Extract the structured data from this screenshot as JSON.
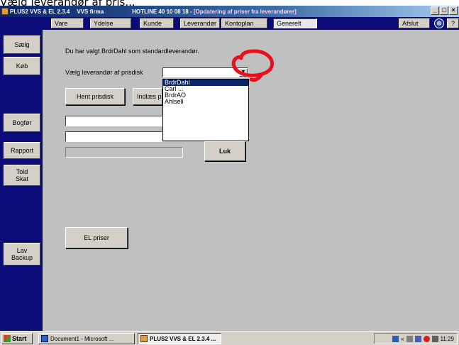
{
  "caption_top": "Vælg leverandør af pris...",
  "window": {
    "title_app": "PLUS2 VVS & EL 2.3.4",
    "title_company": "VVS firma",
    "title_hotline": "HOTLINE 40 10 08 18 - ",
    "title_context": "[Opdatering af priser fra leverandører]",
    "btn_min": "_",
    "btn_max": "□",
    "btn_close": "×"
  },
  "menu": {
    "items": [
      "Vare",
      "Ydelse",
      "Kunde",
      "Leverandør",
      "Kontoplan",
      "Generelt"
    ],
    "exit": "Afslut",
    "help_icon": "?"
  },
  "sidebar": {
    "items": [
      "Sælg",
      "Køb",
      "Bogfør",
      "Rapport",
      "Told\nSkat",
      "Lav\nBackup"
    ]
  },
  "form": {
    "info_text": "Du har valgt BrdrDahl som standardleverandør.",
    "pick_label": "Vælg leverandør af prisdisk",
    "combo_value": "",
    "dropdown_options": [
      "BrdrDahl",
      "Carl ...",
      "BrdrAO",
      "Ahlsell"
    ],
    "dropdown_selected": 0,
    "btn_fetch": "Hent prisdisk",
    "btn_import": "Indlæs p",
    "btn_close": "Luk",
    "btn_el": "EL priser"
  },
  "taskbar": {
    "start": "Start",
    "tasks": [
      "Document1 - Microsoft ...",
      "PLUS2 VVS & EL 2.3.4 ..."
    ],
    "clock": "11:29"
  },
  "colors": {
    "sidebar_bg": "#0a0a78",
    "main_bg": "#c0c0c0",
    "annotation": "#e8101c",
    "title_gradient_start": "#0a246a"
  }
}
